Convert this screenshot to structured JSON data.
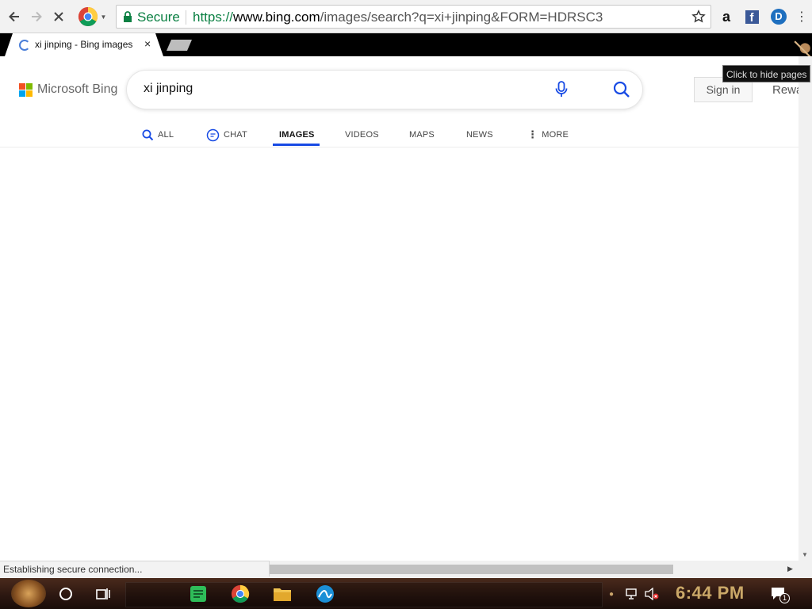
{
  "browser": {
    "omnibox": {
      "secure_label": "Secure",
      "url_scheme": "https://",
      "url_host": "www.bing.com",
      "url_path": "/images/search?q=xi+jinping&FORM=HDRSC3"
    },
    "tab": {
      "title": "xi jinping - Bing images",
      "close": "×"
    },
    "tooltip": "Click to hide pages",
    "extensions": [
      "amazon-icon",
      "facebook-icon",
      "dashlane-icon"
    ]
  },
  "bing": {
    "logo_text": "Microsoft Bing",
    "logo_colors": [
      "#f25022",
      "#7fba00",
      "#00a4ef",
      "#ffb900"
    ],
    "search_query": "xi jinping",
    "sign_in": "Sign in",
    "rewards": "Rewa",
    "accent": "#174ae4",
    "nav": [
      {
        "label": "ALL",
        "icon": "search-icon"
      },
      {
        "label": "CHAT",
        "icon": "chat-icon"
      },
      {
        "label": "IMAGES",
        "active": true
      },
      {
        "label": "VIDEOS"
      },
      {
        "label": "MAPS"
      },
      {
        "label": "NEWS"
      },
      {
        "label": "MORE",
        "icon": "more-vertical-icon"
      }
    ]
  },
  "status_bar": "Establishing secure connection...",
  "taskbar": {
    "clock": "6:44 PM",
    "notification_count": "1"
  }
}
